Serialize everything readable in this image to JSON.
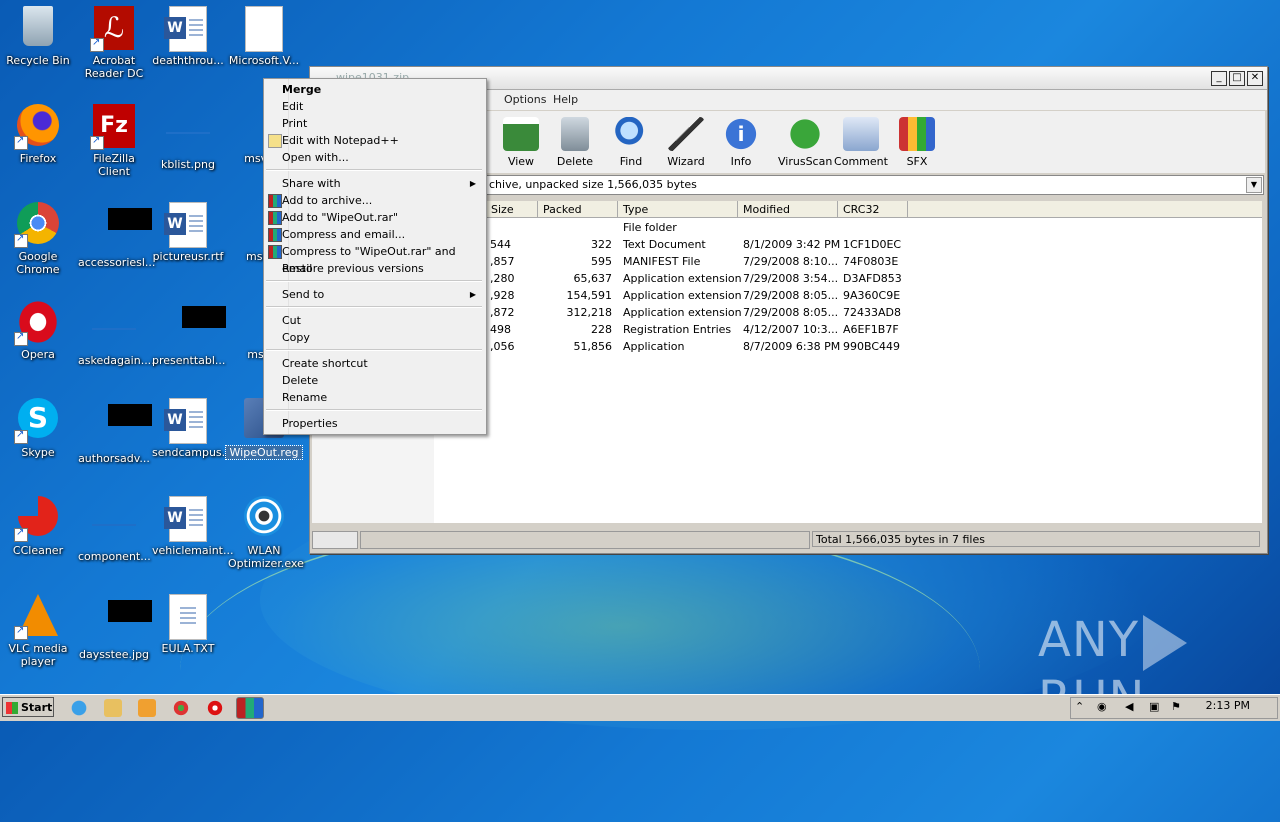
{
  "desktop": {
    "icons": [
      {
        "label": "Recycle Bin"
      },
      {
        "label": "Acrobat Reader DC"
      },
      {
        "label": "deaththrou..."
      },
      {
        "label": "Microsoft.V..."
      },
      {
        "label": "Firefox"
      },
      {
        "label": "FileZilla Client"
      },
      {
        "label": "kblist.png"
      },
      {
        "label": "msvcm"
      },
      {
        "label": "Google Chrome"
      },
      {
        "label": "accessoriesl..."
      },
      {
        "label": "pictureusr.rtf"
      },
      {
        "label": "msvcp"
      },
      {
        "label": "Opera"
      },
      {
        "label": "askedagain...."
      },
      {
        "label": "presenttabl..."
      },
      {
        "label": "msvcr"
      },
      {
        "label": "Skype"
      },
      {
        "label": "authorsadv..."
      },
      {
        "label": "sendcampus..."
      },
      {
        "label": "WipeOut.reg"
      },
      {
        "label": "CCleaner"
      },
      {
        "label": "component..."
      },
      {
        "label": "vehiclemaint..."
      },
      {
        "label": "WLAN Optimizer.exe"
      },
      {
        "label": "VLC media player"
      },
      {
        "label": "daysstee.jpg"
      },
      {
        "label": "EULA.TXT"
      }
    ],
    "watermark": "ANY RUN"
  },
  "winrar": {
    "title": "wipe1031.zip",
    "menu": [
      "Options",
      "Help"
    ],
    "toolbar": [
      "View",
      "Delete",
      "Find",
      "Wizard",
      "Info",
      "VirusScan",
      "Comment",
      "SFX"
    ],
    "address": "chive, unpacked size 1,566,035 bytes",
    "columns": [
      "Size",
      "Packed",
      "Type",
      "Modified",
      "CRC32"
    ],
    "rows": [
      {
        "size": "",
        "packed": "",
        "type": "File folder",
        "modified": "",
        "crc": ""
      },
      {
        "size": "544",
        "packed": "322",
        "type": "Text Document",
        "modified": "8/1/2009 3:42 PM",
        "crc": "1CF1D0EC"
      },
      {
        "size": ",857",
        "packed": "595",
        "type": "MANIFEST File",
        "modified": "7/29/2008 8:10...",
        "crc": "74F0803E"
      },
      {
        "size": ",280",
        "packed": "65,637",
        "type": "Application extension",
        "modified": "7/29/2008 3:54...",
        "crc": "D3AFD853"
      },
      {
        "size": ",928",
        "packed": "154,591",
        "type": "Application extension",
        "modified": "7/29/2008 8:05...",
        "crc": "9A360C9E"
      },
      {
        "size": ",872",
        "packed": "312,218",
        "type": "Application extension",
        "modified": "7/29/2008 8:05...",
        "crc": "72433AD8"
      },
      {
        "size": "498",
        "packed": "228",
        "type": "Registration Entries",
        "modified": "4/12/2007 10:3...",
        "crc": "A6EF1B7F"
      },
      {
        "size": ",056",
        "packed": "51,856",
        "type": "Application",
        "modified": "8/7/2009 6:38 PM",
        "crc": "990BC449"
      }
    ],
    "status": "Total 1,566,035 bytes in 7 files"
  },
  "context_menu": {
    "items": [
      {
        "label": "Merge",
        "bold": true
      },
      {
        "label": "Edit"
      },
      {
        "label": "Print"
      },
      {
        "label": "Edit with Notepad++",
        "icon": "notepad-icon"
      },
      {
        "label": "Open with..."
      },
      {
        "label": "Share with",
        "submenu": true
      },
      {
        "label": "Add to archive...",
        "icon": "winrar-icon"
      },
      {
        "label": "Add to \"WipeOut.rar\"",
        "icon": "winrar-icon"
      },
      {
        "label": "Compress and email...",
        "icon": "winrar-icon"
      },
      {
        "label": "Compress to \"WipeOut.rar\" and email",
        "icon": "winrar-icon"
      },
      {
        "label": "Restore previous versions"
      },
      {
        "label": "Send to",
        "submenu": true
      },
      {
        "label": "Cut"
      },
      {
        "label": "Copy"
      },
      {
        "label": "Create shortcut"
      },
      {
        "label": "Delete"
      },
      {
        "label": "Rename"
      },
      {
        "label": "Properties"
      }
    ]
  },
  "taskbar": {
    "start_label": "Start",
    "clock": "2:13 PM"
  }
}
